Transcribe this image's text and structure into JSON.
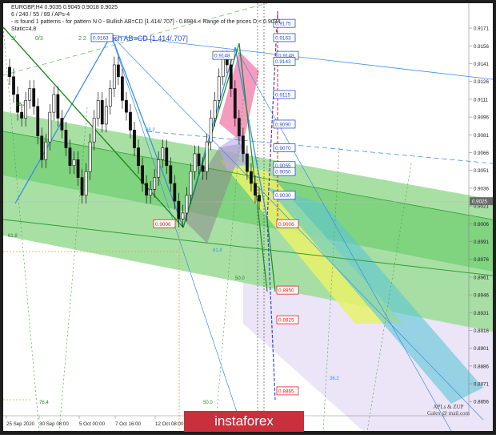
{
  "header": {
    "line1": "EURGBP,H4  0.9035 0.9045 0.9018 0.9025",
    "line2": "6 / 240 / 55 / 89 / APs-4",
    "line3": "- is found 1 patterns  -  for pattern N 0 - Bullish AB=CD [1.414/.707] - 0.8984 < Range of the prices D < 0.9034",
    "line4": "Static=4.8"
  },
  "pattern_label": "Bullish AB=CD [1.414/.707]",
  "fib_labels": [
    "38.2",
    "61.8",
    "38.2",
    "61.8",
    "50.0",
    "38.2",
    "76.4",
    "50.0"
  ],
  "counters": [
    "3/",
    "0/3",
    "2 2"
  ],
  "watermark": [
    "APLs & ZUP",
    "Galex @ mail.com"
  ],
  "logo_text": "instaforex",
  "colors": {
    "green_band": "#3cbd48",
    "yellow_band": "#e8f26a",
    "cyan_band": "#5bc6d6",
    "lavender_band": "#e7dcf5",
    "pink_zone": "#f07aa8",
    "blue_line": "#3a8ee8",
    "red_line": "#e02020",
    "bid_label": "#6b6b6b"
  },
  "chart_data": {
    "type": "candlestick",
    "symbol": "EURGBP",
    "timeframe": "H4",
    "ylim": [
      0.8844,
      0.9192
    ],
    "yticks": [
      "0.9171",
      "0.9156",
      "0.9141",
      "0.9126",
      "0.9111",
      "0.9096",
      "0.9081",
      "0.9066",
      "0.9051",
      "0.9036",
      "0.9021",
      "0.9006",
      "0.8991",
      "0.8976",
      "0.8961",
      "0.8946",
      "0.8931",
      "0.8916",
      "0.8901",
      "0.8886",
      "0.8871",
      "0.8856"
    ],
    "xticks": [
      "25 Sep 2020",
      "30 Sep 08:00",
      "5 Oct 00:00",
      "7 Oct 16:00",
      "12 Oct 08:00"
    ],
    "current_price": "0.9025",
    "level_labels": [
      {
        "text": "0.9175",
        "price": 0.9175,
        "color": "blue"
      },
      {
        "text": "0.9163",
        "price": 0.9163,
        "color": "blue"
      },
      {
        "text": "0.9163",
        "price": 0.9163,
        "color": "blue"
      },
      {
        "text": "0.9148",
        "price": 0.9148,
        "color": "blue"
      },
      {
        "text": "0.9148",
        "price": 0.9148,
        "color": "blue"
      },
      {
        "text": "0.9143",
        "price": 0.9143,
        "color": "blue"
      },
      {
        "text": "0.9115",
        "price": 0.9115,
        "color": "blue"
      },
      {
        "text": "0.9090",
        "price": 0.909,
        "color": "blue"
      },
      {
        "text": "0.9070",
        "price": 0.907,
        "color": "blue"
      },
      {
        "text": "0.9055",
        "price": 0.9055,
        "color": "blue"
      },
      {
        "text": "0.9050",
        "price": 0.905,
        "color": "blue"
      },
      {
        "text": "0.9030",
        "price": 0.903,
        "color": "blue"
      },
      {
        "text": "0.9006",
        "price": 0.9006,
        "color": "red"
      },
      {
        "text": "0.9006",
        "price": 0.9006,
        "color": "red"
      },
      {
        "text": "0.8950",
        "price": 0.895,
        "color": "red"
      },
      {
        "text": "0.8925",
        "price": 0.8925,
        "color": "red"
      },
      {
        "text": "0.8865",
        "price": 0.8865,
        "color": "red"
      }
    ],
    "series": [
      {
        "values": [
          0.913,
          0.9115,
          0.91,
          0.9095,
          0.911,
          0.912,
          0.9105,
          0.908,
          0.906,
          0.9075,
          0.91,
          0.9115,
          0.9095,
          0.9085,
          0.907,
          0.9055,
          0.906,
          0.9045,
          0.903,
          0.905,
          0.9075,
          0.9095,
          0.911,
          0.909,
          0.9105,
          0.912,
          0.914,
          0.913,
          0.911,
          0.91,
          0.9085,
          0.907,
          0.9055,
          0.904,
          0.903,
          0.9035,
          0.9045,
          0.906,
          0.907,
          0.9055,
          0.904,
          0.9025,
          0.901,
          0.9015,
          0.903,
          0.905,
          0.9065,
          0.9055,
          0.905,
          0.9075,
          0.9095,
          0.911,
          0.913,
          0.9145,
          0.914,
          0.912,
          0.9095,
          0.908,
          0.9065,
          0.905,
          0.904,
          0.903,
          0.9025
        ]
      }
    ]
  }
}
